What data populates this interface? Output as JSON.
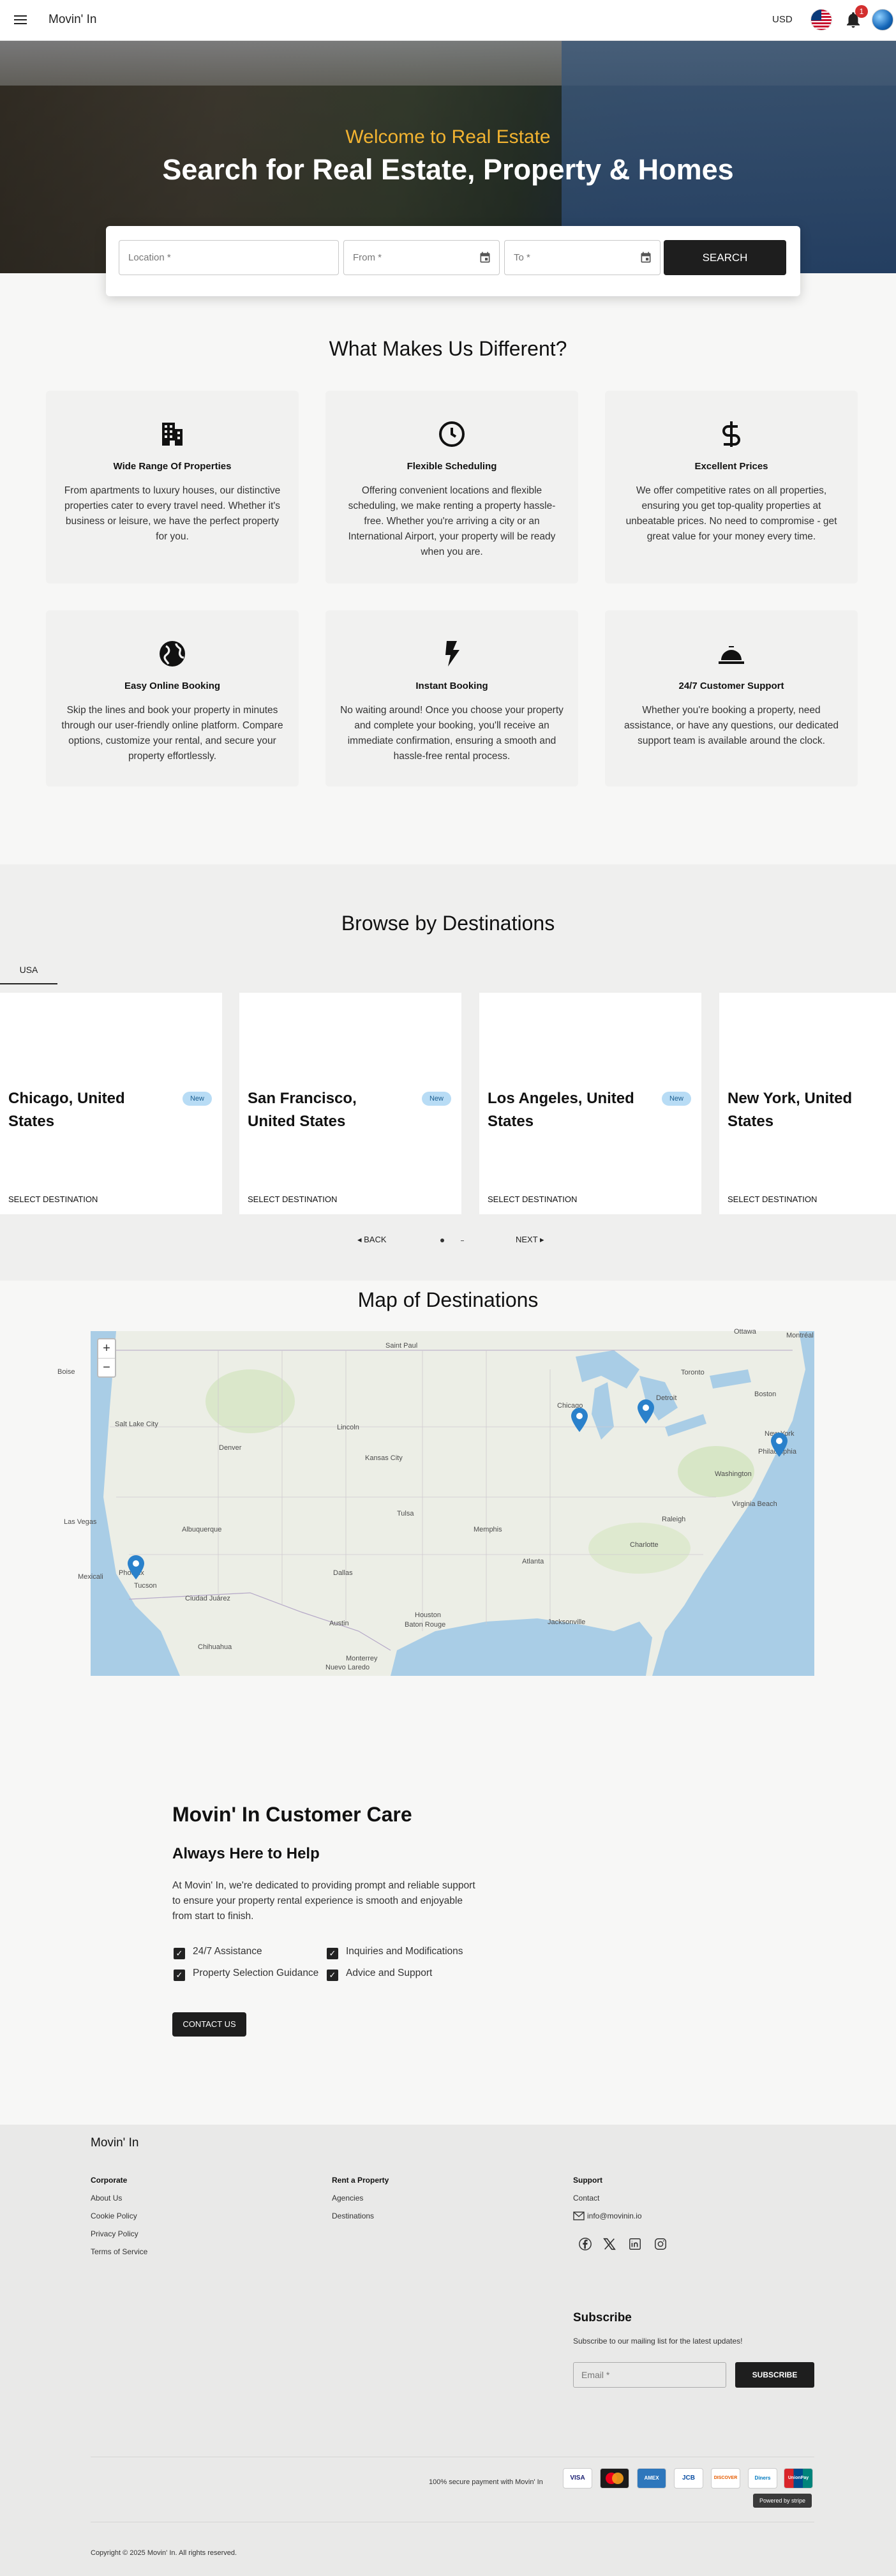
{
  "header": {
    "brand": "Movin' In",
    "currency": "USD",
    "notifications_count": "1",
    "icons": [
      "menu-icon",
      "us-flag-icon",
      "bell-icon",
      "avatar"
    ]
  },
  "hero": {
    "welcome": "Welcome to Real Estate",
    "title": "Search for Real Estate, Property & Homes",
    "accent_color": "#f2b331"
  },
  "search": {
    "location_placeholder": "Location *",
    "from_placeholder": "From *",
    "to_placeholder": "To *",
    "button": "SEARCH"
  },
  "features": {
    "title": "What Makes Us Different?",
    "items": [
      {
        "icon": "building-icon",
        "title": "Wide Range Of Properties",
        "text": "From apartments to luxury houses, our distinctive properties cater to every travel need. Whether it's business or leisure, we have the perfect property for you."
      },
      {
        "icon": "clock-icon",
        "title": "Flexible Scheduling",
        "text": "Offering convenient locations and flexible scheduling, we make renting a property hassle-free. Whether you're arriving a city or an International Airport, your property will be ready when you are."
      },
      {
        "icon": "dollar-icon",
        "title": "Excellent Prices",
        "text": "We offer competitive rates on all properties, ensuring you get top-quality properties at unbeatable prices. No need to compromise - get great value for your money every time."
      },
      {
        "icon": "globe-icon",
        "title": "Easy Online Booking",
        "text": "Skip the lines and book your property in minutes through our user-friendly online platform. Compare options, customize your rental, and secure your property effortlessly."
      },
      {
        "icon": "bolt-icon",
        "title": "Instant Booking",
        "text": "No waiting around! Once you choose your property and complete your booking, you'll receive an immediate confirmation, ensuring a smooth and hassle-free rental process."
      },
      {
        "icon": "service-bell-icon",
        "title": "24/7 Customer Support",
        "text": "Whether you're booking a property, need assistance, or have any questions, our dedicated support team is available around the clock."
      }
    ]
  },
  "destinations": {
    "title": "Browse by Destinations",
    "tab": "USA",
    "cards": [
      {
        "name": "Chicago, United States",
        "badge": "New",
        "action": "SELECT DESTINATION"
      },
      {
        "name": "San Francisco, United States",
        "badge": "New",
        "action": "SELECT DESTINATION"
      },
      {
        "name": "Los Angeles, United States",
        "badge": "New",
        "action": "SELECT DESTINATION"
      },
      {
        "name": "New York, United States",
        "badge": "",
        "action": "SELECT DESTINATION"
      }
    ],
    "back": "BACK",
    "next": "NEXT"
  },
  "map": {
    "title": "Map of Destinations",
    "zoom_in": "+",
    "zoom_out": "−",
    "labels": [
      "Saint Paul",
      "Ottawa",
      "Montréal",
      "Boise",
      "Toronto",
      "Detroit",
      "Chicago",
      "Boston",
      "New York",
      "Philadelphia",
      "Washington",
      "Salt Lake City",
      "Denver",
      "Lincoln",
      "Kansas City",
      "Las Vegas",
      "Albuquerque",
      "Tulsa",
      "Memphis",
      "Atlanta",
      "Charlotte",
      "Raleigh",
      "Virginia Beach",
      "Dallas",
      "Mexicali",
      "Phoenix",
      "Tucson",
      "Ciudad Juárez",
      "Austin",
      "Houston",
      "Baton Rouge",
      "Jacksonville",
      "Monterrey",
      "Chihuahua",
      "Nuevo Laredo"
    ]
  },
  "care": {
    "title": "Movin' In Customer Care",
    "subtitle": "Always Here to Help",
    "text": "At Movin' In, we're dedicated to providing prompt and reliable support to ensure your property rental experience is smooth and enjoyable from start to finish.",
    "checks": [
      "24/7 Assistance",
      "Inquiries and Modifications",
      "Property Selection Guidance",
      "Advice and Support"
    ],
    "button": "CONTACT US"
  },
  "footer": {
    "brand": "Movin' In",
    "corporate": {
      "title": "Corporate",
      "links": [
        "About Us",
        "Cookie Policy",
        "Privacy Policy",
        "Terms of Service"
      ]
    },
    "rent": {
      "title": "Rent a Property",
      "links": [
        "Agencies",
        "Destinations"
      ]
    },
    "support": {
      "title": "Support",
      "links": [
        "Contact"
      ],
      "email": "info@movinin.io"
    },
    "social": [
      "facebook-icon",
      "x-icon",
      "linkedin-icon",
      "instagram-icon"
    ],
    "subscribe": {
      "title": "Subscribe",
      "text": "Subscribe to our mailing list for the latest updates!",
      "placeholder": "Email *",
      "button": "SUBSCRIBE"
    },
    "secure_text": "100% secure payment with Movin' In",
    "payments": [
      "VISA",
      "mastercard",
      "AMEX",
      "JCB",
      "DISCOVER",
      "Diners",
      "UnionPay"
    ],
    "stripe": "Powered by stripe",
    "copyright": "Copyright © 2025 Movin' In. All rights reserved."
  }
}
